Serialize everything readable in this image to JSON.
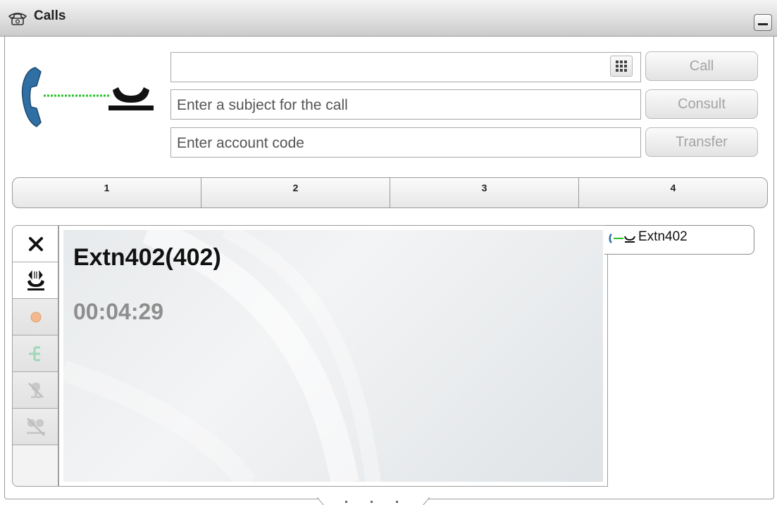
{
  "window": {
    "title": "Calls"
  },
  "dial": {
    "number_value": "",
    "subject_placeholder": "Enter a subject for the call",
    "account_placeholder": "Enter account code"
  },
  "actions": {
    "call": "Call",
    "consult": "Consult",
    "transfer": "Transfer"
  },
  "lines": [
    "1",
    "2",
    "3",
    "4"
  ],
  "toolbar_icons": [
    "close-icon",
    "hold-icon",
    "record-icon",
    "conference-icon",
    "mute-icon",
    "mute-all-icon"
  ],
  "active_call": {
    "caller": "Extn402(402)",
    "duration": "00:04:29"
  },
  "call_list": [
    {
      "label": "Extn402"
    }
  ],
  "colors": {
    "accent_green": "#2ac22a",
    "handset_blue": "#2f6fa3",
    "disabled_text": "#a3a3a3"
  }
}
